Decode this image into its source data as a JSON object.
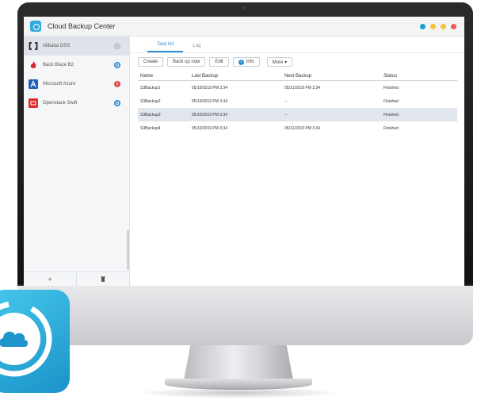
{
  "window": {
    "title": "Cloud Backup Center"
  },
  "traffic_dots": [
    "#1b9ad4",
    "#f5c33b",
    "#f5c33b",
    "#ee5a5a"
  ],
  "sidebar": {
    "items": [
      {
        "label": "Alibaba OSS",
        "icon": "alibaba-logo-icon",
        "badge_color": "#9aa0a6",
        "selected": true
      },
      {
        "label": "Back Blaze B2",
        "icon": "backblaze-flame-icon",
        "badge_color": "#2e8fd6"
      },
      {
        "label": "Microsoft Azure",
        "icon": "azure-logo-icon",
        "badge_color": "#e24b4b"
      },
      {
        "label": "Openstack Swift",
        "icon": "openstack-logo-icon",
        "badge_color": "#2e8fd6"
      }
    ],
    "add_label": "+"
  },
  "tabs": [
    {
      "label": "Task list"
    },
    {
      "label": "Log"
    }
  ],
  "toolbar": {
    "create": "Create",
    "back_up_now": "Back up now",
    "edit": "Edit",
    "info": "Info",
    "more": "More ▾"
  },
  "table": {
    "headers": [
      "Name",
      "Last Backup",
      "Next Backup",
      "Status"
    ],
    "rows": [
      [
        "S3Backup1",
        "05/10/2019 PM 3:34",
        "05/21/2019 PM 3:34",
        "Finished"
      ],
      [
        "S3Backup2",
        "05/10/2019 PM 3:34",
        "--",
        "Finished"
      ],
      [
        "S3Backup3",
        "05/10/2019 PM 3:34",
        "--",
        "Finished"
      ],
      [
        "S3Backup4",
        "05/10/2019 PM 3:34",
        "05/21/2019 PM 3:34",
        "Finished"
      ]
    ],
    "selected_row": 2
  },
  "accent_color": "#2e8fd6"
}
